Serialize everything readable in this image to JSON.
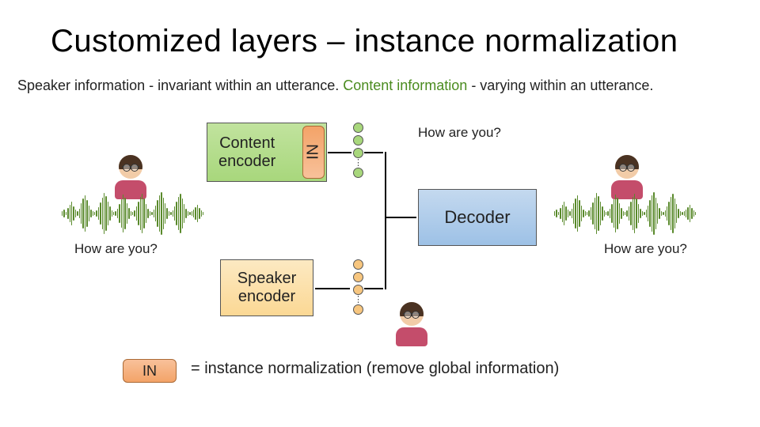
{
  "title": "Customized layers – instance normalization",
  "subtitle_black1": "Speaker information - invariant within an utterance. ",
  "subtitle_green": "Content information",
  "subtitle_black2": " - varying within an utterance.",
  "blocks": {
    "content_encoder": "Content\nencoder",
    "speaker_encoder": "Speaker\nencoder",
    "decoder": "Decoder",
    "in_vert": "IN",
    "in_horiz": "IN"
  },
  "annotations": {
    "top": "How are you?",
    "left": "How are you?",
    "right": "How are you?"
  },
  "legend": "= instance normalization  (remove global information)"
}
